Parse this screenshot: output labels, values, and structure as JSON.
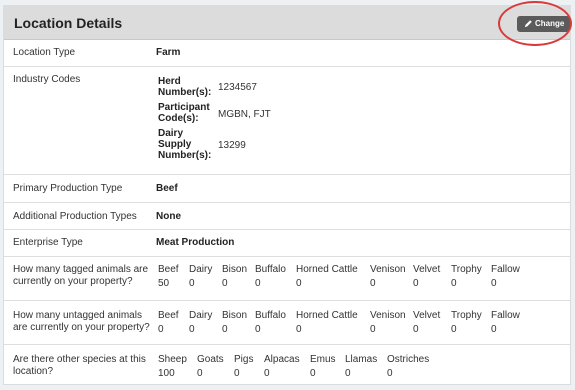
{
  "header": {
    "title": "Location Details",
    "change_label": "Change"
  },
  "location_type": {
    "label": "Location Type",
    "value": "Farm"
  },
  "industry_codes": {
    "label": "Industry Codes",
    "codes": [
      {
        "name": [
          "Herd",
          "Number(s):"
        ],
        "value": "1234567"
      },
      {
        "name": [
          "Participant",
          "Code(s):"
        ],
        "value": "MGBN, FJT"
      },
      {
        "name": [
          "Dairy",
          "Supply",
          "Number(s):"
        ],
        "value": "13299"
      }
    ]
  },
  "primary_production": {
    "label": "Primary Production Type",
    "value": "Beef"
  },
  "additional_production": {
    "label": "Additional Production Types",
    "value": "None"
  },
  "enterprise": {
    "label": "Enterprise Type",
    "value": "Meat Production"
  },
  "tagged": {
    "label": [
      "How many tagged animals are",
      "currently on your property?"
    ],
    "headers": [
      "Beef",
      "Dairy",
      "Bison",
      "Buffalo",
      "Horned Cattle",
      "Venison",
      "Velvet",
      "Trophy",
      "Fallow"
    ],
    "values": [
      "50",
      "0",
      "0",
      "0",
      "0",
      "0",
      "0",
      "0",
      "0"
    ]
  },
  "untagged": {
    "label": [
      "How many untagged animals",
      "are currently on your property?"
    ],
    "headers": [
      "Beef",
      "Dairy",
      "Bison",
      "Buffalo",
      "Horned Cattle",
      "Venison",
      "Velvet",
      "Trophy",
      "Fallow"
    ],
    "values": [
      "0",
      "0",
      "0",
      "0",
      "0",
      "0",
      "0",
      "0",
      "0"
    ]
  },
  "other_species": {
    "label": [
      "Are there other species at this",
      "location?"
    ],
    "headers": [
      "Sheep",
      "Goats",
      "Pigs",
      "Alpacas",
      "Emus",
      "Llamas",
      "Ostriches"
    ],
    "values": [
      "100",
      "0",
      "0",
      "0",
      "0",
      "0",
      "0"
    ]
  }
}
